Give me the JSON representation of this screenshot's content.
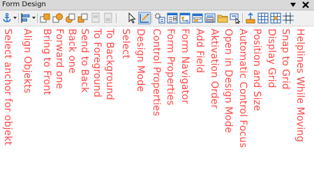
{
  "window": {
    "title": "Form Design"
  },
  "annotations": [
    "Select anchor for objekt",
    "Align Objekts",
    "Bring to Front",
    "Forward one",
    "Back one",
    "Send to Back",
    "To Foreground",
    "To Background",
    "Select",
    "Design Mode",
    "Control Properties",
    "Form Properties",
    "Form Navigator",
    "Add Field",
    "Aktivation Order",
    "Open in Design Mode",
    "Automatic Control Focus",
    "Position and Size",
    "Display Grid",
    "Snap to Grid",
    "Helplines While Moving"
  ],
  "colors": {
    "annotation": "#ff4a4a",
    "titlebar": "#d9d9d9",
    "toolbar": "#f0f0f0",
    "accent_blue": "#1f6fd1",
    "accent_orange": "#f2a12f"
  }
}
